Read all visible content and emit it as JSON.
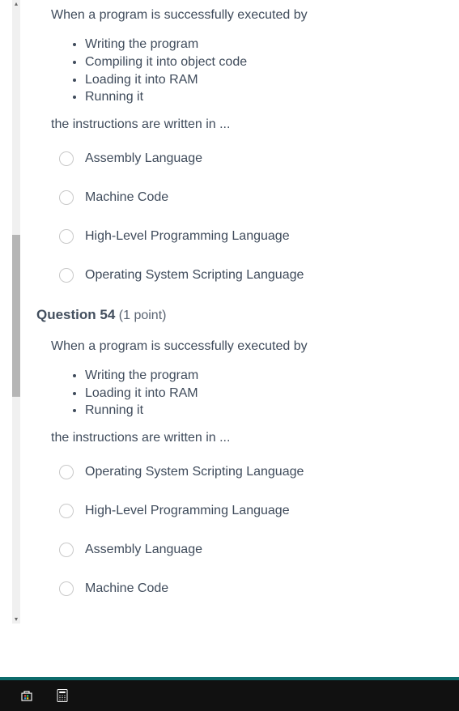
{
  "q53": {
    "stem": "When a program is successfully executed by",
    "bullets": [
      "Writing the program",
      "Compiling it into object code",
      "Loading it into RAM",
      "Running it"
    ],
    "conclude": "the instructions are written in ...",
    "options": [
      "Assembly Language",
      "Machine Code",
      "High-Level Programming Language",
      "Operating System Scripting Language"
    ]
  },
  "q54": {
    "title": "Question 54",
    "points": "(1 point)",
    "stem": "When a program is successfully executed by",
    "bullets": [
      "Writing the program",
      "Loading it into RAM",
      "Running it"
    ],
    "conclude": "the instructions are written in ...",
    "options": [
      "Operating System Scripting Language",
      "High-Level Programming Language",
      "Assembly Language",
      "Machine Code"
    ]
  }
}
